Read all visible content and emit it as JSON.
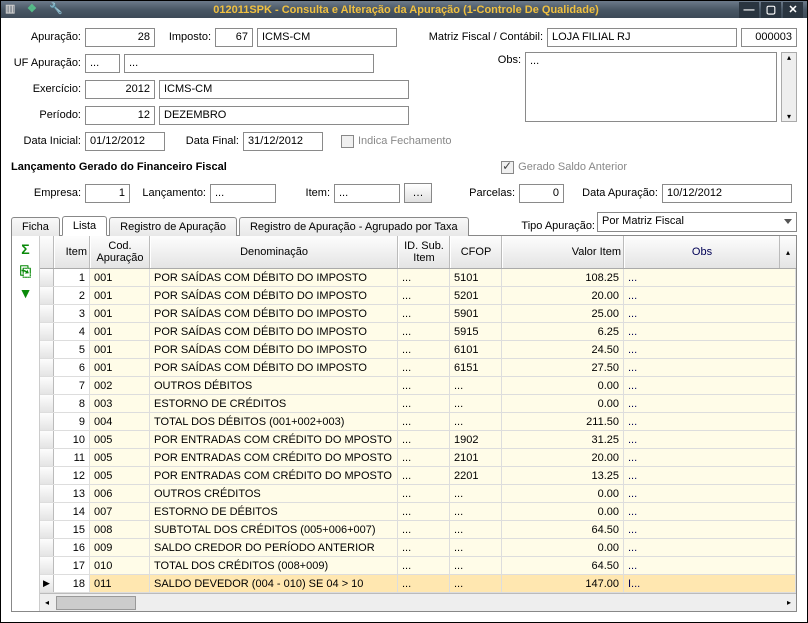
{
  "titlebar": {
    "title": "012011SPK - Consulta e Alteração da Apuração (1-Controle De Qualidade)"
  },
  "form": {
    "apuracao_label": "Apuração:",
    "apuracao": "28",
    "imposto_label": "Imposto:",
    "imposto_code": "67",
    "imposto_desc": "ICMS-CM",
    "matriz_label": "Matriz Fiscal / Contábil:",
    "matriz_desc": "LOJA FILIAL RJ",
    "matriz_code": "000003",
    "uf_label": "UF Apuração:",
    "uf_code": "...",
    "uf_desc": "...",
    "obs_label": "Obs:",
    "obs_value": "...",
    "exercicio_label": "Exercício:",
    "exercicio": "2012",
    "exercicio_desc": "ICMS-CM",
    "periodo_label": "Período:",
    "periodo": "12",
    "periodo_desc": "DEZEMBRO",
    "data_inicial_label": "Data Inicial:",
    "data_inicial": "01/12/2012",
    "data_final_label": "Data Final:",
    "data_final": "31/12/2012",
    "indica_fechamento": "Indica Fechamento",
    "gerado_saldo": "Gerado Saldo Anterior",
    "lancamento_header": "Lançamento Gerado do Financeiro Fiscal",
    "empresa_label": "Empresa:",
    "empresa": "1",
    "lancamento_label": "Lançamento:",
    "lancamento": "...",
    "item_label": "Item:",
    "item": "...",
    "parcelas_label": "Parcelas:",
    "parcelas": "0",
    "data_apuracao_label": "Data Apuração:",
    "data_apuracao": "10/12/2012",
    "tipo_label": "Tipo Apuração:",
    "tipo_value": "Por Matriz Fiscal"
  },
  "tabs": {
    "ficha": "Ficha",
    "lista": "Lista",
    "reg": "Registro de Apuração",
    "reg_taxa": "Registro de Apuração - Agrupado por Taxa"
  },
  "grid": {
    "headers": {
      "item": "Item",
      "cod": "Cod. Apuração",
      "den": "Denominação",
      "ids": "ID. Sub. Item",
      "cfop": "CFOP",
      "val": "Valor Item",
      "obs": "Obs"
    },
    "rows": [
      {
        "item": "1",
        "cod": "001",
        "den": "POR SAÍDAS COM DÉBITO DO IMPOSTO",
        "ids": "...",
        "cfop": "5101",
        "val": "108.25",
        "obs": "..."
      },
      {
        "item": "2",
        "cod": "001",
        "den": "POR SAÍDAS COM DÉBITO DO IMPOSTO",
        "ids": "...",
        "cfop": "5201",
        "val": "20.00",
        "obs": "..."
      },
      {
        "item": "3",
        "cod": "001",
        "den": "POR SAÍDAS COM DÉBITO DO IMPOSTO",
        "ids": "...",
        "cfop": "5901",
        "val": "25.00",
        "obs": "..."
      },
      {
        "item": "4",
        "cod": "001",
        "den": "POR SAÍDAS COM DÉBITO DO IMPOSTO",
        "ids": "...",
        "cfop": "5915",
        "val": "6.25",
        "obs": "..."
      },
      {
        "item": "5",
        "cod": "001",
        "den": "POR SAÍDAS COM DÉBITO DO IMPOSTO",
        "ids": "...",
        "cfop": "6101",
        "val": "24.50",
        "obs": "..."
      },
      {
        "item": "6",
        "cod": "001",
        "den": "POR SAÍDAS COM DÉBITO DO IMPOSTO",
        "ids": "...",
        "cfop": "6151",
        "val": "27.50",
        "obs": "..."
      },
      {
        "item": "7",
        "cod": "002",
        "den": "OUTROS DÉBITOS",
        "ids": "...",
        "cfop": "...",
        "val": "0.00",
        "obs": "..."
      },
      {
        "item": "8",
        "cod": "003",
        "den": "ESTORNO DE CRÉDITOS",
        "ids": "...",
        "cfop": "...",
        "val": "0.00",
        "obs": "..."
      },
      {
        "item": "9",
        "cod": "004",
        "den": "TOTAL DOS DÉBITOS (001+002+003)",
        "ids": "...",
        "cfop": "...",
        "val": "211.50",
        "obs": "..."
      },
      {
        "item": "10",
        "cod": "005",
        "den": "POR ENTRADAS COM CRÉDITO DO MPOSTO",
        "ids": "...",
        "cfop": "1902",
        "val": "31.25",
        "obs": "..."
      },
      {
        "item": "11",
        "cod": "005",
        "den": "POR ENTRADAS COM CRÉDITO DO MPOSTO",
        "ids": "...",
        "cfop": "2101",
        "val": "20.00",
        "obs": "..."
      },
      {
        "item": "12",
        "cod": "005",
        "den": "POR ENTRADAS COM CRÉDITO DO MPOSTO",
        "ids": "...",
        "cfop": "2201",
        "val": "13.25",
        "obs": "..."
      },
      {
        "item": "13",
        "cod": "006",
        "den": "OUTROS CRÉDITOS",
        "ids": "...",
        "cfop": "...",
        "val": "0.00",
        "obs": "..."
      },
      {
        "item": "14",
        "cod": "007",
        "den": "ESTORNO DE DÉBITOS",
        "ids": "...",
        "cfop": "...",
        "val": "0.00",
        "obs": "..."
      },
      {
        "item": "15",
        "cod": "008",
        "den": "SUBTOTAL DOS CRÉDITOS (005+006+007)",
        "ids": "...",
        "cfop": "...",
        "val": "64.50",
        "obs": "..."
      },
      {
        "item": "16",
        "cod": "009",
        "den": "SALDO CREDOR DO PERÍODO ANTERIOR",
        "ids": "...",
        "cfop": "...",
        "val": "0.00",
        "obs": "..."
      },
      {
        "item": "17",
        "cod": "010",
        "den": "TOTAL DOS CRÉDITOS (008+009)",
        "ids": "...",
        "cfop": "...",
        "val": "64.50",
        "obs": "..."
      },
      {
        "item": "18",
        "cod": "011",
        "den": "SALDO DEVEDOR (004 - 010) SE 04 > 10",
        "ids": "...",
        "cfop": "...",
        "val": "147.00",
        "obs": "I..."
      }
    ]
  }
}
